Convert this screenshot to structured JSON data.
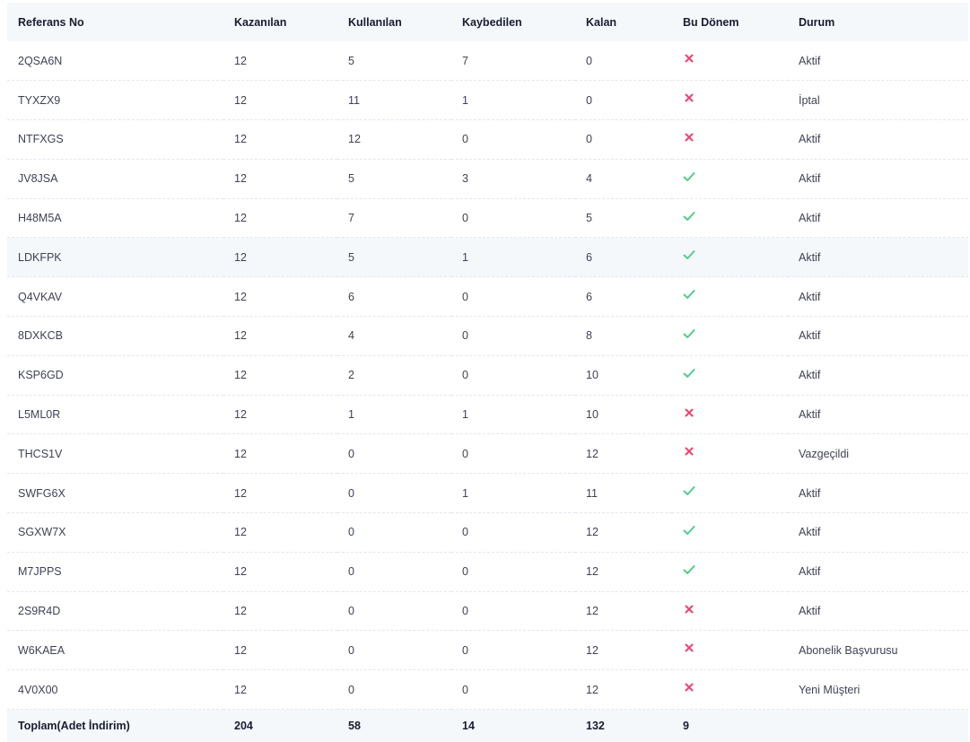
{
  "table": {
    "headers": {
      "ref": "Referans No",
      "kazanilan": "Kazanılan",
      "kullanilan": "Kullanılan",
      "kaybedilen": "Kaybedilen",
      "kalan": "Kalan",
      "bu_donem": "Bu Dönem",
      "durum": "Durum"
    },
    "rows": [
      {
        "ref": "2QSA6N",
        "kazanilan": "12",
        "kullanilan": "5",
        "kaybedilen": "7",
        "kalan": "0",
        "bu_donem": "cross-icon",
        "durum": "Aktif"
      },
      {
        "ref": "TYXZX9",
        "kazanilan": "12",
        "kullanilan": "11",
        "kaybedilen": "1",
        "kalan": "0",
        "bu_donem": "cross-icon",
        "durum": "İptal"
      },
      {
        "ref": "NTFXGS",
        "kazanilan": "12",
        "kullanilan": "12",
        "kaybedilen": "0",
        "kalan": "0",
        "bu_donem": "cross-icon",
        "durum": "Aktif"
      },
      {
        "ref": "JV8JSA",
        "kazanilan": "12",
        "kullanilan": "5",
        "kaybedilen": "3",
        "kalan": "4",
        "bu_donem": "check-icon",
        "durum": "Aktif"
      },
      {
        "ref": "H48M5A",
        "kazanilan": "12",
        "kullanilan": "7",
        "kaybedilen": "0",
        "kalan": "5",
        "bu_donem": "check-icon",
        "durum": "Aktif"
      },
      {
        "ref": "LDKFPK",
        "kazanilan": "12",
        "kullanilan": "5",
        "kaybedilen": "1",
        "kalan": "6",
        "bu_donem": "check-icon",
        "durum": "Aktif"
      },
      {
        "ref": "Q4VKAV",
        "kazanilan": "12",
        "kullanilan": "6",
        "kaybedilen": "0",
        "kalan": "6",
        "bu_donem": "check-icon",
        "durum": "Aktif"
      },
      {
        "ref": "8DXKCB",
        "kazanilan": "12",
        "kullanilan": "4",
        "kaybedilen": "0",
        "kalan": "8",
        "bu_donem": "check-icon",
        "durum": "Aktif"
      },
      {
        "ref": "KSP6GD",
        "kazanilan": "12",
        "kullanilan": "2",
        "kaybedilen": "0",
        "kalan": "10",
        "bu_donem": "check-icon",
        "durum": "Aktif"
      },
      {
        "ref": "L5ML0R",
        "kazanilan": "12",
        "kullanilan": "1",
        "kaybedilen": "1",
        "kalan": "10",
        "bu_donem": "cross-icon",
        "durum": "Aktif"
      },
      {
        "ref": "THCS1V",
        "kazanilan": "12",
        "kullanilan": "0",
        "kaybedilen": "0",
        "kalan": "12",
        "bu_donem": "cross-icon",
        "durum": "Vazgeçildi"
      },
      {
        "ref": "SWFG6X",
        "kazanilan": "12",
        "kullanilan": "0",
        "kaybedilen": "1",
        "kalan": "11",
        "bu_donem": "check-icon",
        "durum": "Aktif"
      },
      {
        "ref": "SGXW7X",
        "kazanilan": "12",
        "kullanilan": "0",
        "kaybedilen": "0",
        "kalan": "12",
        "bu_donem": "check-icon",
        "durum": "Aktif"
      },
      {
        "ref": "M7JPPS",
        "kazanilan": "12",
        "kullanilan": "0",
        "kaybedilen": "0",
        "kalan": "12",
        "bu_donem": "check-icon",
        "durum": "Aktif"
      },
      {
        "ref": "2S9R4D",
        "kazanilan": "12",
        "kullanilan": "0",
        "kaybedilen": "0",
        "kalan": "12",
        "bu_donem": "cross-icon",
        "durum": "Aktif"
      },
      {
        "ref": "W6KAEA",
        "kazanilan": "12",
        "kullanilan": "0",
        "kaybedilen": "0",
        "kalan": "12",
        "bu_donem": "cross-icon",
        "durum": "Abonelik Başvurusu"
      },
      {
        "ref": "4V0X00",
        "kazanilan": "12",
        "kullanilan": "0",
        "kaybedilen": "0",
        "kalan": "12",
        "bu_donem": "cross-icon",
        "durum": "Yeni Müşteri"
      }
    ],
    "highlighted_row": 5,
    "footer": {
      "label": "Toplam(Adet İndirim)",
      "kazanilan": "204",
      "kullanilan": "58",
      "kaybedilen": "14",
      "kalan": "132",
      "bu_donem": "9"
    }
  },
  "colors": {
    "check": "#50cd89",
    "cross": "#f1416c",
    "header_bg": "#f5f8fa",
    "row_highlight_bg": "#f5f8fa"
  }
}
